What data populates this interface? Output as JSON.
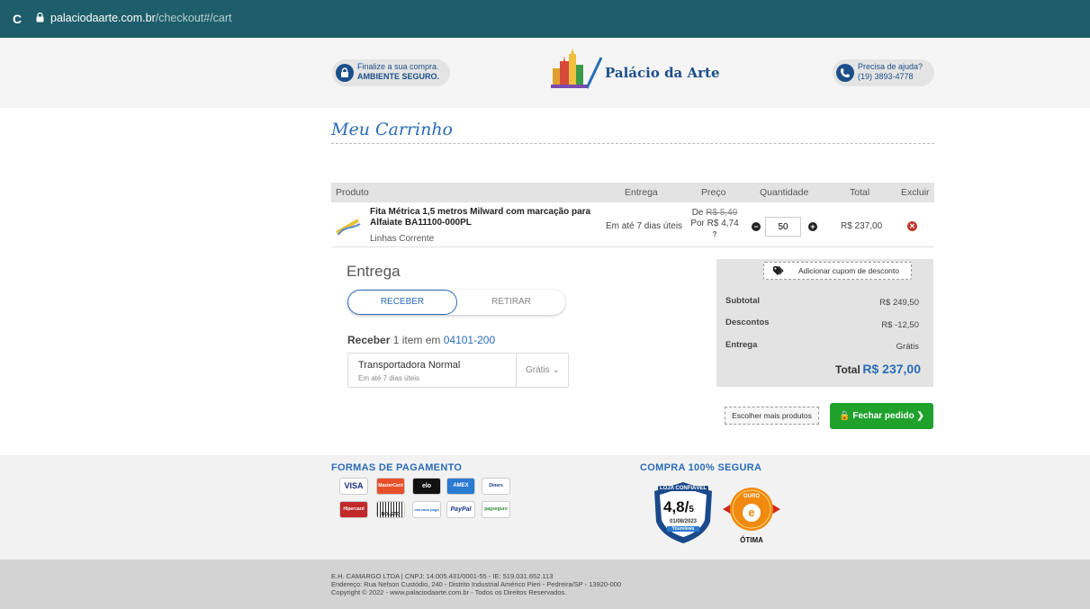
{
  "browser": {
    "url_domain": "palaciodaarte.com.br",
    "url_path": "/checkout#/cart"
  },
  "header": {
    "secure_line1": "Finalize a sua compra.",
    "secure_line2": "AMBIENTE SEGURO.",
    "brand": "Palácio da Arte",
    "help_line1": "Precisa de ajuda?",
    "help_line2": "(19) 3893-4778"
  },
  "cart": {
    "title": "Meu Carrinho",
    "columns": {
      "product": "Produto",
      "delivery": "Entrega",
      "price": "Preço",
      "quantity": "Quantidade",
      "total": "Total",
      "remove": "Excluir"
    },
    "item": {
      "name": "Fita Métrica 1,5 metros Milward com marcação para Alfaiate BA11100-000PL",
      "brand": "Linhas Corrente",
      "delivery": "Em até 7 dias úteis",
      "price_from_label": "De ",
      "price_from": "R$ 5,49",
      "price_by": "Por R$ 4,74",
      "quantity": "50",
      "total": "R$ 237,00"
    }
  },
  "shipping": {
    "title": "Entrega",
    "tab_receive": "RECEBER",
    "tab_pickup": "RETIRAR",
    "receive_bold": "Receber",
    "receive_text": " 1 item em ",
    "cep": "04101-200",
    "option_name": "Transportadora Normal",
    "option_sub": "Em até 7 dias úteis",
    "option_price": "Grátis ⌄"
  },
  "summary": {
    "coupon": "Adicionar cupom de desconto",
    "subtotal_label": "Subtotal",
    "subtotal": "R$ 249,50",
    "discount_label": "Descontos",
    "discount": "R$ -12,50",
    "shipping_label": "Entrega",
    "shipping": "Grátis",
    "total_label": "Total",
    "total": "R$ 237,00",
    "more_products": "Escolher mais produtos",
    "checkout": "🔒 Fechar pedido ❯"
  },
  "footer": {
    "payment_title": "FORMAS DE PAGAMENTO",
    "secure_title": "COMPRA 100% SEGURA",
    "payment_methods": [
      "VISA",
      "MasterCard",
      "elo",
      "AMEX",
      "Diners",
      "Hipercard",
      "BOLETO",
      "mercado pago",
      "PayPal",
      "pagseguro"
    ],
    "badge_trusted": "LOJA CONFIÁVEL",
    "badge_score": "4,8/",
    "badge_score_max": "5",
    "badge_date": "01/08/2023",
    "badge_source": "Yourviews",
    "gold_label": "OURO",
    "gold_rating": "ÓTIMA"
  },
  "legal": {
    "line1": "E.H. CAMARGO LTDA | CNPJ: 14.005.431/0001-55 - IE: 519.031.652.113",
    "line2": "Endereço: Rua Nelson Custódio, 240 - Distrito Industrial Américo Pieri - Pedreira/SP - 13920-000",
    "line3": "Copyright © 2022 - www.palaciodaarte.com.br - Todos os Direitos Reservados."
  },
  "colors": {
    "brand_blue": "#2a6cb8",
    "checkout_green": "#1fa12c",
    "browser_bar": "#1d5e6a"
  }
}
